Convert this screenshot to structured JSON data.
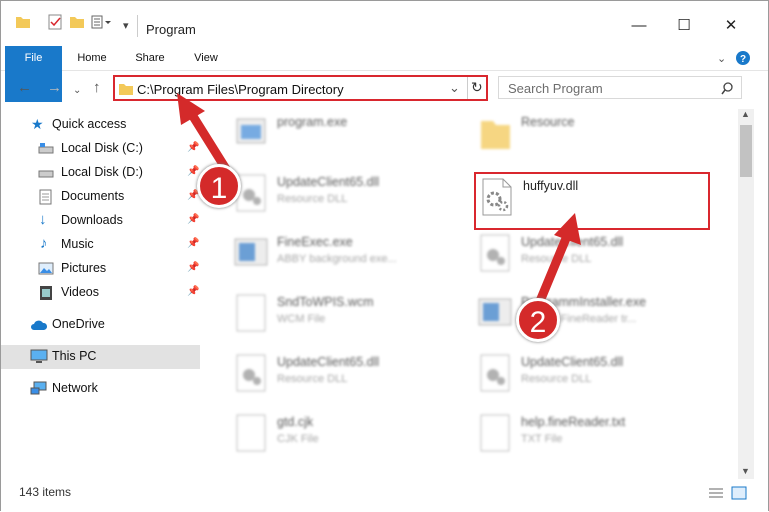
{
  "window": {
    "title": "Program"
  },
  "ribbon": {
    "tabs": [
      "File",
      "Home",
      "Share",
      "View"
    ]
  },
  "address": {
    "path": "C:\\Program Files\\Program Directory"
  },
  "search": {
    "placeholder": "Search Program"
  },
  "nav": {
    "quick_access": "Quick access",
    "items": [
      "Local Disk (C:)",
      "Local Disk (D:)",
      "Documents",
      "Downloads",
      "Music",
      "Pictures",
      "Videos"
    ],
    "onedrive": "OneDrive",
    "thispc": "This PC",
    "network": "Network"
  },
  "files": [
    {
      "name": "program.exe",
      "type": ""
    },
    {
      "name": "Resource",
      "type": ""
    },
    {
      "name": "UpdateClient65.dll",
      "type": "Resource DLL"
    },
    {
      "name": "huffyuv.dll",
      "type": ""
    },
    {
      "name": "FineExec.exe",
      "type": "ABBY background exe..."
    },
    {
      "name": "UpdateClient65.dll",
      "type": "Resource DLL"
    },
    {
      "name": "SndToWPIS.wcm",
      "type": "WCM File"
    },
    {
      "name": "ProgrammInstaller.exe",
      "type": "ABBYY FineReader tr..."
    },
    {
      "name": "UpdateClient65.dll",
      "type": "Resource DLL"
    },
    {
      "name": "UpdateClient65.dll",
      "type": "Resource DLL"
    },
    {
      "name": "gtd.cjk",
      "type": "CJK File"
    },
    {
      "name": "help.fineReader.txt",
      "type": "TXT File"
    }
  ],
  "status": {
    "items": "143 items"
  },
  "callouts": [
    "1",
    "2"
  ],
  "colors": {
    "highlight": "#d9272e",
    "accent": "#1979ca"
  }
}
